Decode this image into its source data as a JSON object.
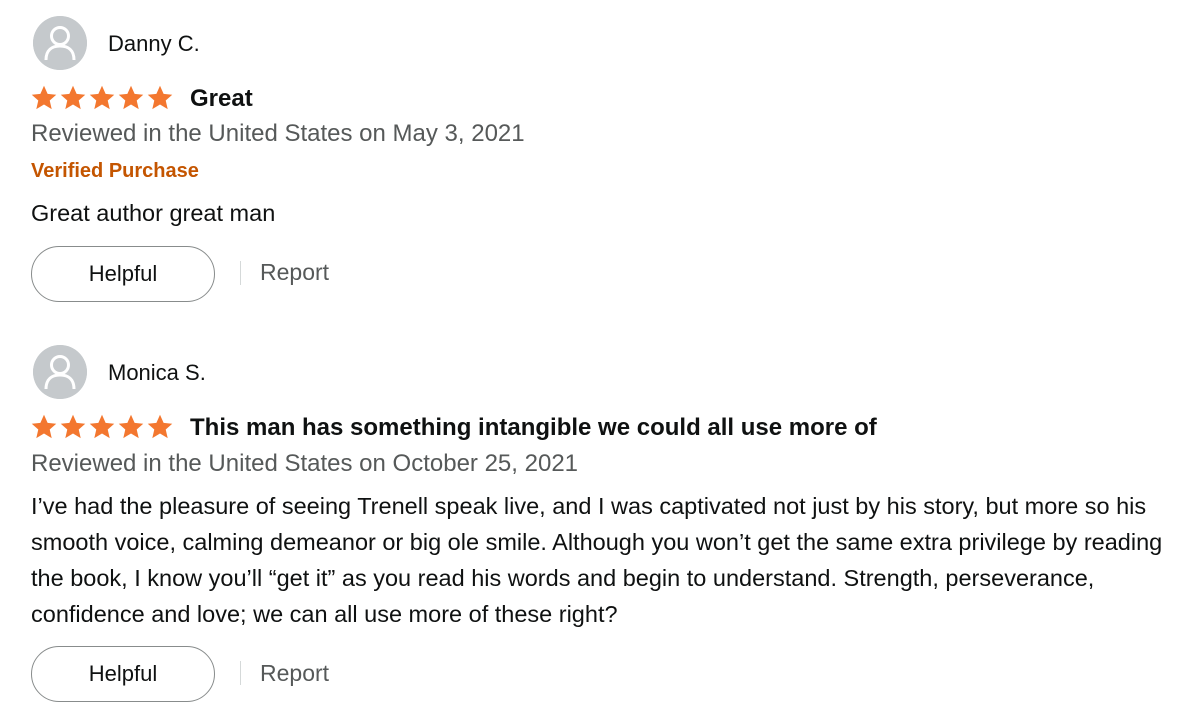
{
  "colors": {
    "star": "#f3772f",
    "verified": "#c45500",
    "meta": "#565959",
    "avatar_bg": "#c5c9cc"
  },
  "reviews": [
    {
      "reviewer": "Danny C.",
      "rating": 5,
      "title": "Great",
      "meta": "Reviewed in the United States on May 3, 2021",
      "verified": "Verified Purchase",
      "body": "Great author great man",
      "helpful_label": "Helpful",
      "report_label": "Report",
      "avatar_icon": "user-silhouette-icon"
    },
    {
      "reviewer": "Monica S.",
      "rating": 5,
      "title": "This man has something intangible we could all use more of",
      "meta": "Reviewed in the United States on October 25, 2021",
      "body": "I’ve had the pleasure of seeing Trenell speak live, and I was captivated not just by his story, but more so his smooth voice, calming demeanor or big ole smile. Although you won’t get the same extra privilege by reading the book, I know you’ll “get it” as you read his words and begin to understand. Strength, perseverance, confidence and love; we can all use more of these right?",
      "helpful_label": "Helpful",
      "report_label": "Report",
      "avatar_icon": "user-silhouette-icon"
    }
  ]
}
